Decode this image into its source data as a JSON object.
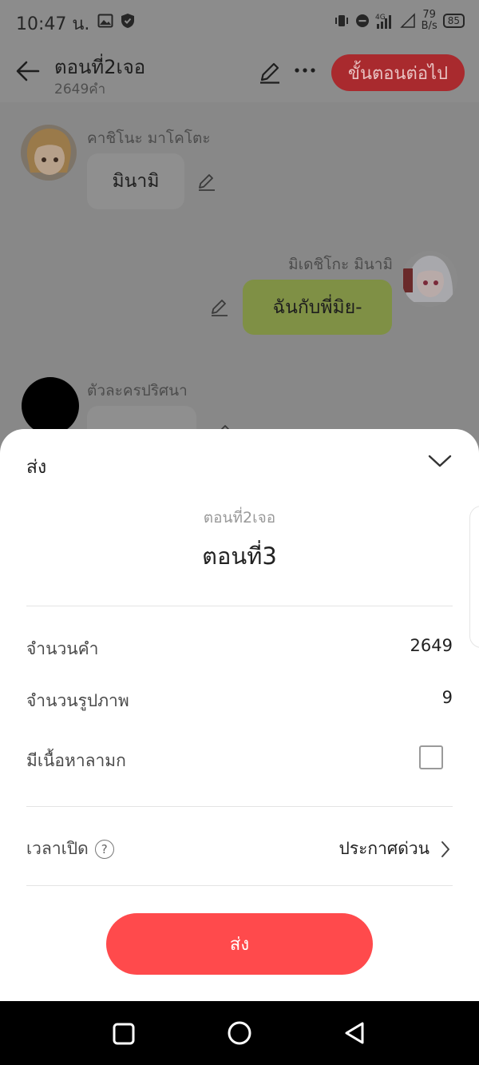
{
  "status_bar": {
    "time": "10:47 น.",
    "net_speed_value": "79",
    "net_speed_unit": "B/s",
    "battery": "85",
    "network": "4G"
  },
  "app_bar": {
    "title": "ตอนที่2เจอ",
    "subtitle": "2649คำ",
    "next_button": "ขั้นตอนต่อไป"
  },
  "chat": {
    "messages": [
      {
        "side": "left",
        "name": "คาชิโนะ มาโคโตะ",
        "text": "มินามิ"
      },
      {
        "side": "right",
        "name": "มิเดชิโกะ มินามิ",
        "text": "ฉันกับพี่มิย-"
      },
      {
        "side": "left",
        "name": "ตัวละครปริศนา",
        "text": ""
      }
    ]
  },
  "sheet": {
    "title": "ส่ง",
    "episode_sub": "ตอนที่2เจอ",
    "episode_main": "ตอนที่3",
    "word_count_label": "จำนวนคำ",
    "word_count_value": "2649",
    "image_count_label": "จำนวนรูปภาพ",
    "image_count_value": "9",
    "mature_label": "มีเนื้อหาลามก",
    "mature_checked": false,
    "open_time_label": "เวลาเปิด",
    "help_glyph": "?",
    "open_time_value": "ประกาศด่วน",
    "send_button": "ส่ง"
  },
  "colors": {
    "accent": "#ff4a4c",
    "next_button_dimmed": "#a92a2e",
    "right_bubble": "#7f9045",
    "left_bubble": "#8f8f8f"
  }
}
